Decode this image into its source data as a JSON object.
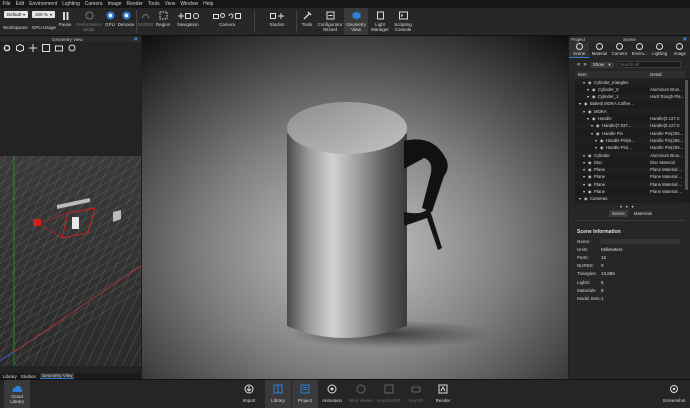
{
  "menu": [
    "File",
    "Edit",
    "Environment",
    "Lighting",
    "Camera",
    "Image",
    "Render",
    "Tools",
    "View",
    "Window",
    "Help"
  ],
  "toolbar": {
    "workspace_value": "Default",
    "zoom_value": "100 %",
    "workspaces": "Workspaces",
    "gpu_usage": "GPU Usage",
    "pause": "Pause",
    "performance_mode": "Performance\nMode",
    "gpu": "GPU",
    "denoise": "Denoise",
    "nurbs": "NURBS",
    "region": "Region",
    "navigation": "Navigation",
    "camera": "Camera",
    "studios": "Studios",
    "tools": "Tools",
    "configurator_wizard": "Configurator\nWizard",
    "geometry_view": "Geometry\nView",
    "light_manager": "Light\nManager",
    "scripting_console": "Scripting\nConsole"
  },
  "geometry_panel": {
    "title": "Geometry View",
    "tabs": [
      "Library",
      "Studios",
      "Geometry View"
    ]
  },
  "project_panel": {
    "title": "Project",
    "scene_title": "Scene",
    "tabs": [
      "Scene",
      "Material",
      "Camera",
      "Enviro...",
      "Lighting",
      "Image"
    ],
    "filter_value": "Show",
    "search_placeholder": "Search All",
    "col_item": "Item",
    "col_detail": "Detail",
    "tree": [
      {
        "indent": 1,
        "name": "Cylinder_triangles",
        "detail": ""
      },
      {
        "indent": 2,
        "name": "Cylinder_0",
        "detail": "Aluminum Brus..."
      },
      {
        "indent": 2,
        "name": "Cylinder_1",
        "detail": "Hard Rough Pla..."
      },
      {
        "indent": 0,
        "name": "Bialetti MOKA Coffee...",
        "detail": ""
      },
      {
        "indent": 1,
        "name": "MOKA",
        "detail": ""
      },
      {
        "indent": 2,
        "name": "Handle",
        "detail": "Handle(0.127.0"
      },
      {
        "indent": 3,
        "name": "Handle(7.037...",
        "detail": "Handle(0.127.0"
      },
      {
        "indent": 3,
        "name": "Handle Pin",
        "detail": "Handle Pin(255..."
      },
      {
        "indent": 4,
        "name": "Handle Pin(6...",
        "detail": "Handle Pin(255..."
      },
      {
        "indent": 4,
        "name": "Handle Pin(...",
        "detail": "Handle Pin(255..."
      },
      {
        "indent": 1,
        "name": "Cylinder",
        "detail": "Aluminum Brus..."
      },
      {
        "indent": 1,
        "name": "Disc",
        "detail": "Disc Material"
      },
      {
        "indent": 1,
        "name": "Plane",
        "detail": "Plane Material ..."
      },
      {
        "indent": 1,
        "name": "Plane",
        "detail": "Plane Material ..."
      },
      {
        "indent": 1,
        "name": "Plane",
        "detail": "Plane Material ..."
      },
      {
        "indent": 1,
        "name": "Plane",
        "detail": "Plane Material ..."
      },
      {
        "indent": 0,
        "name": "Cameras",
        "detail": ""
      }
    ],
    "sub_tabs": [
      "Scene",
      "Materials"
    ]
  },
  "scene_info": {
    "title": "Scene Information",
    "rows": [
      {
        "k": "Name:",
        "v": ""
      },
      {
        "k": "Units:",
        "v": "Millimeters"
      },
      {
        "k": "Parts:",
        "v": "12"
      },
      {
        "k": "NURBS:",
        "v": "0"
      },
      {
        "k": "Triangles:",
        "v": "13,686"
      },
      {
        "k": "Lights:",
        "v": "5"
      },
      {
        "k": "Materials:",
        "v": "9"
      },
      {
        "k": "Model Sets:",
        "v": "1"
      }
    ]
  },
  "bottom_bar": {
    "cloud_library": "Cloud\nLibrary",
    "import": "Import",
    "library": "Library",
    "project": "Project",
    "animation": "Animation",
    "web_viewer": "Web Viewer",
    "keyshotxr": "KeyShotXR",
    "keyvr": "KeyVR",
    "render": "Render",
    "screenshot": "Screenshot"
  },
  "colors": {
    "accent": "#2f7fd8",
    "background": "#1e1e1e",
    "toolbar": "#272727"
  }
}
